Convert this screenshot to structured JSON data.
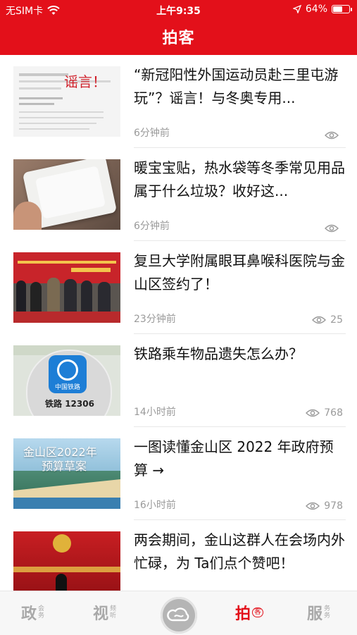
{
  "status": {
    "carrier": "无SIM卡",
    "time": "上午9:35",
    "battery": "64%",
    "battery_level": 0.64
  },
  "header": {
    "title": "拍客"
  },
  "items": [
    {
      "title": "“新冠阳性外国运动员赴三里屯游玩”？谣言！与冬奥专用...",
      "time": "6分钟前",
      "views": "",
      "thumb_overlay": "谣言！",
      "thumb_icon": "rumor-document-thumbnail"
    },
    {
      "title": "暖宝宝贴，热水袋等冬季常见用品属于什么垃圾？收好这...",
      "time": "6分钟前",
      "views": "",
      "thumb_overlay": "",
      "thumb_icon": "heat-pack-thumbnail"
    },
    {
      "title": "复旦大学附属眼耳鼻喉科医院与金山区签约了！",
      "time": "23分钟前",
      "views": "25",
      "thumb_overlay": "",
      "thumb_icon": "signing-ceremony-thumbnail"
    },
    {
      "title": "铁路乘车物品遗失怎么办？",
      "time": "14小时前",
      "views": "768",
      "thumb_overlay": "铁路 12306",
      "thumb_sub": "中国铁路",
      "thumb_icon": "railway-app-thumbnail"
    },
    {
      "title": "一图读懂金山区 2022 年政府预算 →",
      "time": "16小时前",
      "views": "978",
      "thumb_overlay": "金山区2022年",
      "thumb_overlay2": "预算草案",
      "thumb_icon": "budget-aerial-thumbnail"
    },
    {
      "title": "两会期间，金山这群人在会场内外忙碌，为 Ta们点个赞吧！",
      "time": "",
      "views": "",
      "thumb_overlay": "",
      "thumb_icon": "conference-thumbnail"
    }
  ],
  "tabbar": {
    "tabs": [
      {
        "big": "政",
        "small1": "会",
        "small2": "务"
      },
      {
        "big": "视",
        "small1": "频",
        "small2": "听"
      },
      {
        "big": "拍",
        "small1": "客",
        "small2": ""
      },
      {
        "big": "服",
        "small1": "务",
        "small2": "务"
      }
    ]
  },
  "colors": {
    "brand": "#e3101a",
    "muted": "#9a9a9a"
  }
}
